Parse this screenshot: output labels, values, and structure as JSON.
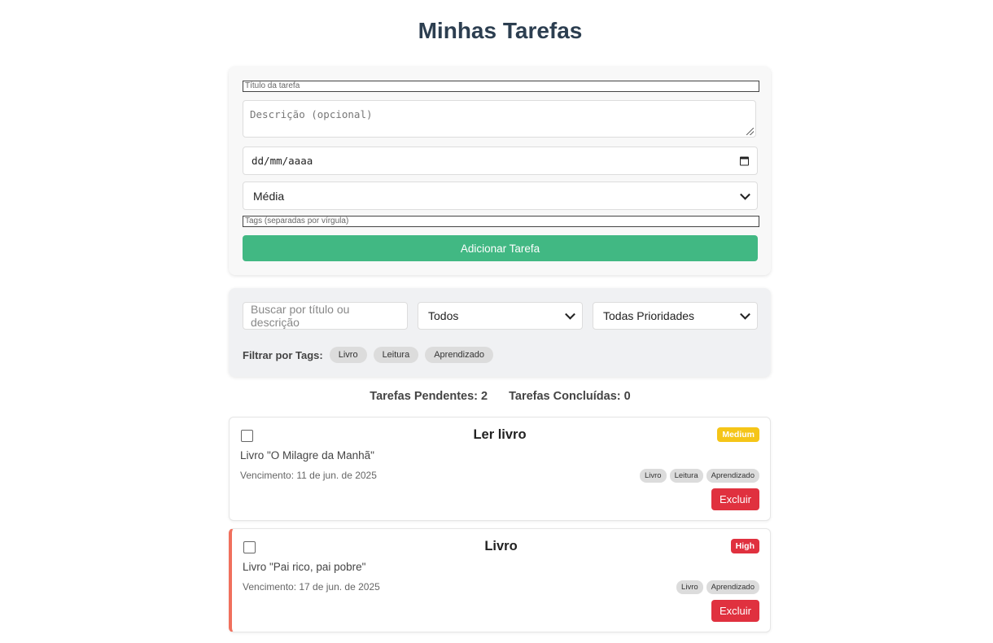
{
  "header": {
    "title": "Minhas Tarefas"
  },
  "form": {
    "title_placeholder": "Título da tarefa",
    "description_placeholder": "Descrição (opcional)",
    "date_placeholder": "dd/mm/aaaa",
    "priority_value": "Média",
    "tags_placeholder": "Tags (separadas por vírgula)",
    "add_button": "Adicionar Tarefa",
    "accent_color": "#41b883"
  },
  "filters": {
    "search_placeholder": "Buscar por título ou descrição",
    "status_value": "Todos",
    "priority_value": "Todas Prioridades",
    "tags_label": "Filtrar por Tags:",
    "tags": [
      "Livro",
      "Leitura",
      "Aprendizado"
    ]
  },
  "counters": {
    "pending": "Tarefas Pendentes: 2",
    "completed": "Tarefas Concluídas: 0"
  },
  "tasks": [
    {
      "title": "Ler livro",
      "priority": "Medium",
      "priority_color": "#f5c518",
      "description": "Livro \"O Milagre da Manhã\"",
      "due": "Vencimento: 11 de jun. de 2025",
      "tags": [
        "Livro",
        "Leitura",
        "Aprendizado"
      ],
      "delete_label": "Excluir",
      "completed": false
    },
    {
      "title": "Livro",
      "priority": "High",
      "priority_color": "#e0313f",
      "description": "Livro \"Pai rico, pai pobre\"",
      "due": "Vencimento: 17 de jun. de 2025",
      "tags": [
        "Livro",
        "Aprendizado"
      ],
      "delete_label": "Excluir",
      "completed": false
    }
  ]
}
